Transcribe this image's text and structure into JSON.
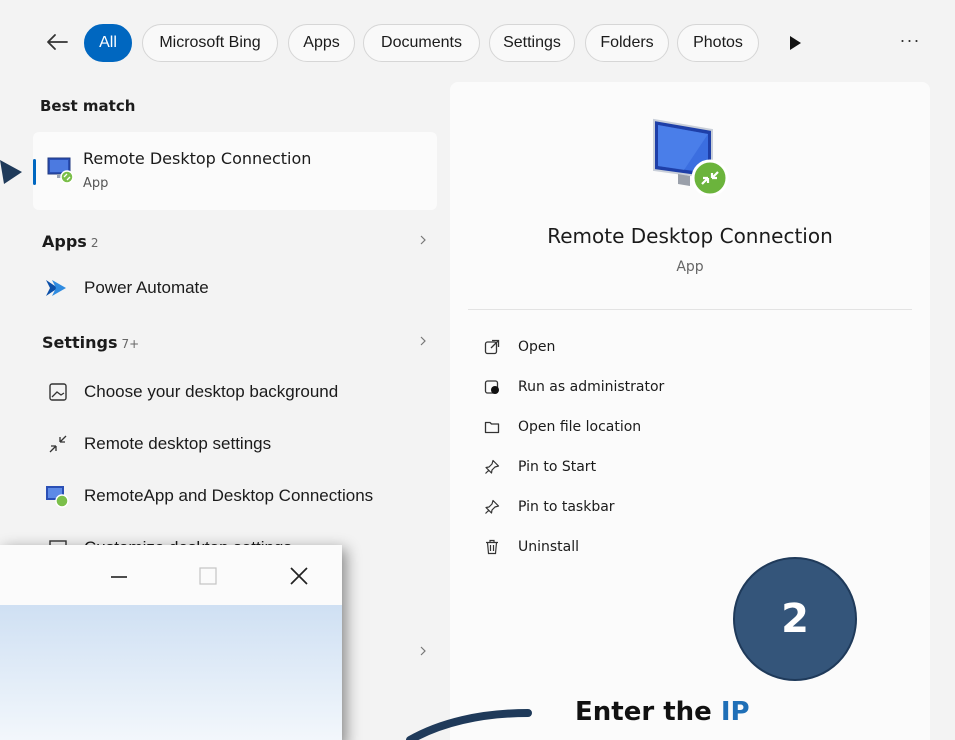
{
  "filters": {
    "back_icon": "arrow-left",
    "tabs": [
      {
        "label": "All",
        "active": true
      },
      {
        "label": "Microsoft Bing",
        "active": false
      },
      {
        "label": "Apps",
        "active": false
      },
      {
        "label": "Documents",
        "active": false
      },
      {
        "label": "Settings",
        "active": false
      },
      {
        "label": "Folders",
        "active": false
      },
      {
        "label": "Photos",
        "active": false
      }
    ],
    "more_label": "···",
    "accent_color": "#0067c0"
  },
  "best_match": {
    "heading": "Best match",
    "title": "Remote Desktop Connection",
    "subtitle": "App"
  },
  "apps": {
    "heading": "Apps",
    "count": "2",
    "items": [
      {
        "label": "Power Automate",
        "icon": "power-automate-icon"
      }
    ]
  },
  "settings": {
    "heading": "Settings",
    "count": "7+",
    "items": [
      {
        "label": "Choose your desktop background",
        "icon": "picture-icon"
      },
      {
        "label": "Remote desktop settings",
        "icon": "remote-arrows-icon"
      },
      {
        "label": "RemoteApp and Desktop Connections",
        "icon": "remoteapp-icon"
      },
      {
        "label": "Customize desktop settings",
        "icon": "desktop-icon"
      }
    ]
  },
  "detail": {
    "title": "Remote Desktop Connection",
    "subtitle": "App",
    "actions": [
      {
        "label": "Open",
        "icon": "open-external-icon"
      },
      {
        "label": "Run as administrator",
        "icon": "shield-admin-icon"
      },
      {
        "label": "Open file location",
        "icon": "folder-icon"
      },
      {
        "label": "Pin to Start",
        "icon": "pin-icon"
      },
      {
        "label": "Pin to taskbar",
        "icon": "pin-icon"
      },
      {
        "label": "Uninstall",
        "icon": "trash-icon"
      }
    ]
  },
  "overlay": {
    "step_number": "2",
    "callout_prefix": "Enter the",
    "callout_highlight": "IP",
    "badge_color": "#34557a",
    "highlight_color": "#1f6fb7"
  }
}
